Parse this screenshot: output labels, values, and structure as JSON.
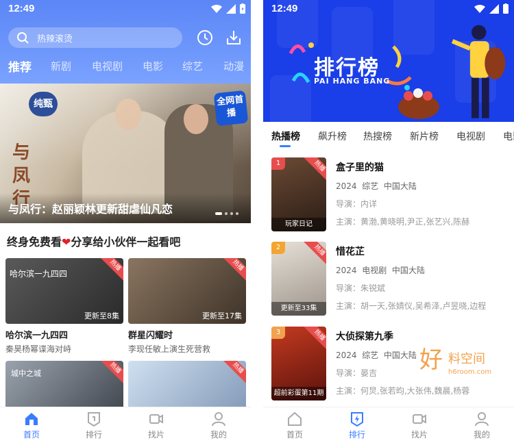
{
  "left": {
    "status": {
      "time": "12:49"
    },
    "search": {
      "placeholder": "热辣滚烫"
    },
    "tabs": [
      "推荐",
      "新剧",
      "电视剧",
      "电影",
      "综艺",
      "动漫"
    ],
    "banner": {
      "caption": "与凤行：赵丽颖林更新甜虐仙凡恋",
      "badge_pure": "纯甄",
      "badge_first": "全网首播",
      "calligraphy": "与凤行"
    },
    "section": {
      "title_before": "终身免费看",
      "title_after": "分享给小伙伴一起看吧"
    },
    "cards": [
      {
        "title": "哈尔滨一九四四",
        "sub": "秦昊杨幂谍海对峙",
        "ep": "更新至8集",
        "hot": "热播",
        "logo": "哈尔滨一九四四",
        "color": "#3a3a3a"
      },
      {
        "title": "群星闪耀时",
        "sub": "李现任敏上演生死营救",
        "ep": "更新至17集",
        "hot": "热播",
        "logo": "",
        "color": "#6b5a45"
      },
      {
        "title": "",
        "sub": "",
        "ep": "",
        "hot": "热播",
        "logo": "城中之城",
        "color": "#4a4f5a"
      },
      {
        "title": "",
        "sub": "",
        "ep": "",
        "hot": "热播",
        "logo": "",
        "color": "#9fb6d0"
      }
    ],
    "nav": [
      "首页",
      "排行",
      "找片",
      "我的"
    ]
  },
  "right": {
    "status": {
      "time": "12:49"
    },
    "header": {
      "title": "排行榜",
      "subtitle": "PAI HANG BANG"
    },
    "tabs": [
      "热播榜",
      "飙升榜",
      "热搜榜",
      "新片榜",
      "电视剧",
      "电影"
    ],
    "items": [
      {
        "rank": "1",
        "name": "盒子里的猫",
        "year": "2024",
        "type": "综艺",
        "region": "中国大陆",
        "director_label": "导演：",
        "director": "内详",
        "cast_label": "主演：",
        "cast": "黄渤,黄晓明,尹正,张艺兴,陈赫",
        "poster_text": "玩家日记",
        "rank_color": "#e84d4d",
        "poster_color": "#3d2c22"
      },
      {
        "rank": "2",
        "name": "惜花芷",
        "year": "2024",
        "type": "电视剧",
        "region": "中国大陆",
        "director_label": "导演：",
        "director": "朱锐斌",
        "cast_label": "主演：",
        "cast": "胡一天,张婧仪,吴希泽,卢昱晓,边程",
        "poster_text": "更新至33集",
        "rank_color": "#f3a531",
        "poster_color": "#cfc6bd"
      },
      {
        "rank": "3",
        "name": "大侦探第九季",
        "year": "2024",
        "type": "综艺",
        "region": "中国大陆",
        "director_label": "导演：",
        "director": "晏吉",
        "cast_label": "主演：",
        "cast": "何炅,张若昀,大张伟,魏晨,杨蓉",
        "poster_text": "超前彩蛋第11期",
        "rank_color": "#f2a24d",
        "poster_color": "#7a2118"
      }
    ],
    "watermark": {
      "big": "好",
      "mid": "料空间",
      "url": "h6room.com"
    },
    "nav": [
      "首页",
      "排行",
      "找片",
      "我的"
    ]
  },
  "colors": {
    "accent": "#3b7cff",
    "left_header": "#5b86f6",
    "right_header": "#1a3ee8",
    "hot": "#e84d4d"
  }
}
